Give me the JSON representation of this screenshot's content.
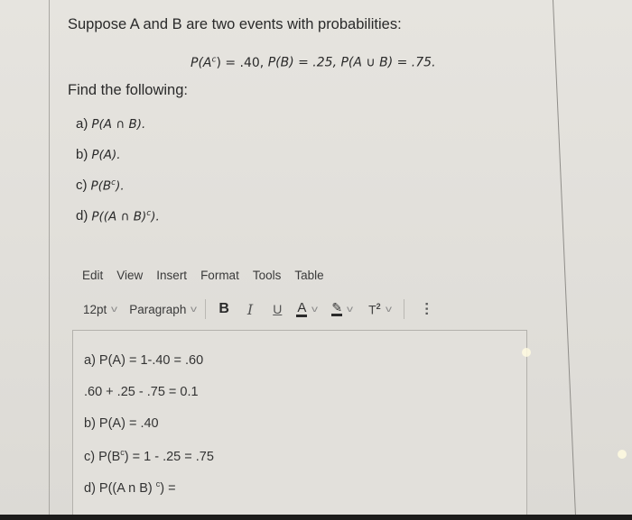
{
  "question": {
    "intro": "Suppose A and B are two events with probabilities:",
    "formula": {
      "p_ac": "P(A",
      "p_ac_sup": "c",
      "p_ac_val": ") = .40, ",
      "p_b": "P(B) = .25, ",
      "p_aub": "P(A ∪ B) = .75."
    },
    "find_label": "Find the following:",
    "parts": [
      {
        "label": "a)",
        "expr": "P(A ∩ B).",
        "sup": ""
      },
      {
        "label": "b)",
        "expr": "P(A).",
        "sup": ""
      },
      {
        "label": "c)",
        "expr_pre": "P(B",
        "sup": "c",
        "expr_post": ")."
      },
      {
        "label": "d)",
        "expr_pre": "P((A ∩ B)",
        "sup": "c",
        "expr_post": ")."
      }
    ]
  },
  "editor": {
    "menu": [
      "Edit",
      "View",
      "Insert",
      "Format",
      "Tools",
      "Table"
    ],
    "toolbar": {
      "font_size": "12pt",
      "block_format": "Paragraph",
      "bold": "B",
      "italic": "I",
      "underline": "U",
      "font_color": "A",
      "highlight_icon": "pen-highlight-icon",
      "superscript": "T",
      "superscript_sup": "2",
      "more_icon": "more-vertical-icon"
    },
    "content": [
      {
        "pre": "a) P(A) = 1-.40 = .60",
        "sup": "",
        "post": ""
      },
      {
        "pre": ".60 + .25 - .75 = 0.1",
        "sup": "",
        "post": ""
      },
      {
        "pre": "b) P(A) = .40",
        "sup": "",
        "post": ""
      },
      {
        "pre": "c) P(B",
        "sup": "c",
        "post": ") = 1 - .25 = .75"
      },
      {
        "pre": "d) P((A n B) ",
        "sup": "c",
        "post": ") ="
      }
    ]
  }
}
